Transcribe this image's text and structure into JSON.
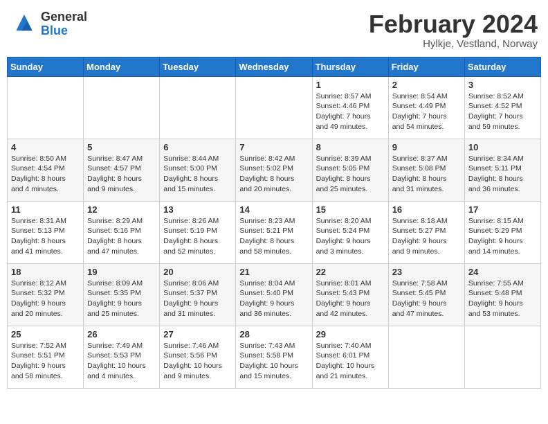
{
  "header": {
    "logo_general": "General",
    "logo_blue": "Blue",
    "title": "February 2024",
    "subtitle": "Hylkje, Vestland, Norway"
  },
  "weekdays": [
    "Sunday",
    "Monday",
    "Tuesday",
    "Wednesday",
    "Thursday",
    "Friday",
    "Saturday"
  ],
  "weeks": [
    [
      {
        "day": "",
        "info": ""
      },
      {
        "day": "",
        "info": ""
      },
      {
        "day": "",
        "info": ""
      },
      {
        "day": "",
        "info": ""
      },
      {
        "day": "1",
        "info": "Sunrise: 8:57 AM\nSunset: 4:46 PM\nDaylight: 7 hours\nand 49 minutes."
      },
      {
        "day": "2",
        "info": "Sunrise: 8:54 AM\nSunset: 4:49 PM\nDaylight: 7 hours\nand 54 minutes."
      },
      {
        "day": "3",
        "info": "Sunrise: 8:52 AM\nSunset: 4:52 PM\nDaylight: 7 hours\nand 59 minutes."
      }
    ],
    [
      {
        "day": "4",
        "info": "Sunrise: 8:50 AM\nSunset: 4:54 PM\nDaylight: 8 hours\nand 4 minutes."
      },
      {
        "day": "5",
        "info": "Sunrise: 8:47 AM\nSunset: 4:57 PM\nDaylight: 8 hours\nand 9 minutes."
      },
      {
        "day": "6",
        "info": "Sunrise: 8:44 AM\nSunset: 5:00 PM\nDaylight: 8 hours\nand 15 minutes."
      },
      {
        "day": "7",
        "info": "Sunrise: 8:42 AM\nSunset: 5:02 PM\nDaylight: 8 hours\nand 20 minutes."
      },
      {
        "day": "8",
        "info": "Sunrise: 8:39 AM\nSunset: 5:05 PM\nDaylight: 8 hours\nand 25 minutes."
      },
      {
        "day": "9",
        "info": "Sunrise: 8:37 AM\nSunset: 5:08 PM\nDaylight: 8 hours\nand 31 minutes."
      },
      {
        "day": "10",
        "info": "Sunrise: 8:34 AM\nSunset: 5:11 PM\nDaylight: 8 hours\nand 36 minutes."
      }
    ],
    [
      {
        "day": "11",
        "info": "Sunrise: 8:31 AM\nSunset: 5:13 PM\nDaylight: 8 hours\nand 41 minutes."
      },
      {
        "day": "12",
        "info": "Sunrise: 8:29 AM\nSunset: 5:16 PM\nDaylight: 8 hours\nand 47 minutes."
      },
      {
        "day": "13",
        "info": "Sunrise: 8:26 AM\nSunset: 5:19 PM\nDaylight: 8 hours\nand 52 minutes."
      },
      {
        "day": "14",
        "info": "Sunrise: 8:23 AM\nSunset: 5:21 PM\nDaylight: 8 hours\nand 58 minutes."
      },
      {
        "day": "15",
        "info": "Sunrise: 8:20 AM\nSunset: 5:24 PM\nDaylight: 9 hours\nand 3 minutes."
      },
      {
        "day": "16",
        "info": "Sunrise: 8:18 AM\nSunset: 5:27 PM\nDaylight: 9 hours\nand 9 minutes."
      },
      {
        "day": "17",
        "info": "Sunrise: 8:15 AM\nSunset: 5:29 PM\nDaylight: 9 hours\nand 14 minutes."
      }
    ],
    [
      {
        "day": "18",
        "info": "Sunrise: 8:12 AM\nSunset: 5:32 PM\nDaylight: 9 hours\nand 20 minutes."
      },
      {
        "day": "19",
        "info": "Sunrise: 8:09 AM\nSunset: 5:35 PM\nDaylight: 9 hours\nand 25 minutes."
      },
      {
        "day": "20",
        "info": "Sunrise: 8:06 AM\nSunset: 5:37 PM\nDaylight: 9 hours\nand 31 minutes."
      },
      {
        "day": "21",
        "info": "Sunrise: 8:04 AM\nSunset: 5:40 PM\nDaylight: 9 hours\nand 36 minutes."
      },
      {
        "day": "22",
        "info": "Sunrise: 8:01 AM\nSunset: 5:43 PM\nDaylight: 9 hours\nand 42 minutes."
      },
      {
        "day": "23",
        "info": "Sunrise: 7:58 AM\nSunset: 5:45 PM\nDaylight: 9 hours\nand 47 minutes."
      },
      {
        "day": "24",
        "info": "Sunrise: 7:55 AM\nSunset: 5:48 PM\nDaylight: 9 hours\nand 53 minutes."
      }
    ],
    [
      {
        "day": "25",
        "info": "Sunrise: 7:52 AM\nSunset: 5:51 PM\nDaylight: 9 hours\nand 58 minutes."
      },
      {
        "day": "26",
        "info": "Sunrise: 7:49 AM\nSunset: 5:53 PM\nDaylight: 10 hours\nand 4 minutes."
      },
      {
        "day": "27",
        "info": "Sunrise: 7:46 AM\nSunset: 5:56 PM\nDaylight: 10 hours\nand 9 minutes."
      },
      {
        "day": "28",
        "info": "Sunrise: 7:43 AM\nSunset: 5:58 PM\nDaylight: 10 hours\nand 15 minutes."
      },
      {
        "day": "29",
        "info": "Sunrise: 7:40 AM\nSunset: 6:01 PM\nDaylight: 10 hours\nand 21 minutes."
      },
      {
        "day": "",
        "info": ""
      },
      {
        "day": "",
        "info": ""
      }
    ]
  ]
}
